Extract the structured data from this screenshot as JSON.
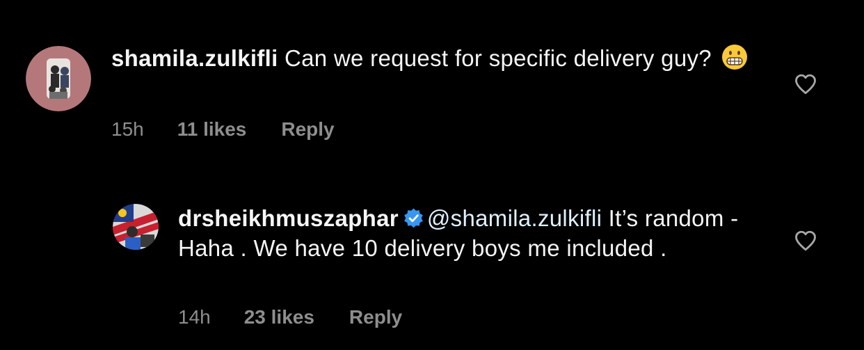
{
  "comments": [
    {
      "username": "shamila.zulkifli",
      "text": "Can we request for specific delivery guy?",
      "emoji": "grimacing-face",
      "time": "15h",
      "likes": "11 likes",
      "reply_label": "Reply"
    },
    {
      "username": "drsheikhmuszaphar",
      "verified": true,
      "mention": "@shamila.zulkifli",
      "text": "It’s random - Haha . We have 10 delivery boys me included .",
      "time": "14h",
      "likes": "23 likes",
      "reply_label": "Reply"
    }
  ],
  "icons": {
    "like": "heart-outline-icon",
    "verified": "verified-badge-icon"
  },
  "colors": {
    "background": "#000000",
    "text": "#f5f5f5",
    "meta": "#8e8e8e",
    "verified": "#3897f0",
    "mention": "#e0f1ff"
  }
}
